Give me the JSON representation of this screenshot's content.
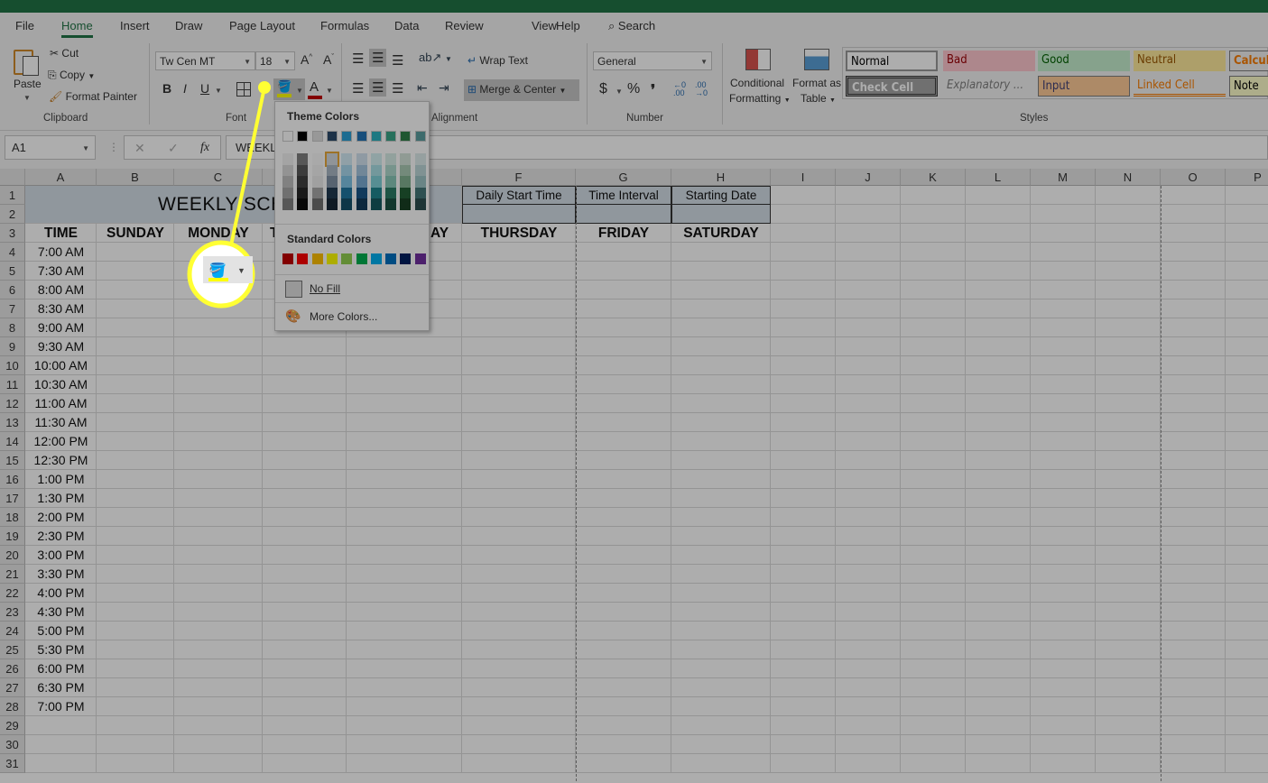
{
  "titlebar": {
    "color": "#217346"
  },
  "tabs": [
    {
      "label": "File"
    },
    {
      "label": "Home",
      "active": true
    },
    {
      "label": "Insert"
    },
    {
      "label": "Draw"
    },
    {
      "label": "Page Layout"
    },
    {
      "label": "Formulas"
    },
    {
      "label": "Data"
    },
    {
      "label": "Review"
    },
    {
      "label": "View"
    },
    {
      "label": "Help"
    }
  ],
  "search": {
    "label": "Search",
    "icon": "search-icon"
  },
  "clipboard": {
    "paste": "Paste",
    "cut": "Cut",
    "copy": "Copy",
    "format_painter": "Format Painter",
    "group": "Clipboard"
  },
  "font": {
    "name": "Tw Cen MT",
    "size": "18",
    "bold": "B",
    "italic": "I",
    "underline": "U",
    "font_color_glyph": "A",
    "group": "Font",
    "fill_color": "#ffff00",
    "font_color": "#c00000"
  },
  "alignment": {
    "wrap_text": "Wrap Text",
    "merge_center": "Merge & Center",
    "group": "Alignment"
  },
  "number": {
    "format": "General",
    "currency": "$",
    "percent": "%",
    "comma": "❜",
    "group": "Number"
  },
  "styles_group": {
    "conditional_1": "Conditional",
    "conditional_2": "Formatting",
    "table_1": "Format as",
    "table_2": "Table",
    "group": "Styles",
    "items": [
      {
        "label": "Normal",
        "bg": "#ffffff",
        "fg": "#000000"
      },
      {
        "label": "Bad",
        "bg": "#ffc7ce",
        "fg": "#9c0006"
      },
      {
        "label": "Good",
        "bg": "#c6efce",
        "fg": "#006100"
      },
      {
        "label": "Neutral",
        "bg": "#ffeb9c",
        "fg": "#9c5700"
      },
      {
        "label": "Calcul",
        "bg": "#f2f2f2",
        "fg": "#fa7d00"
      },
      {
        "label": "Check Cell",
        "bg": "#a5a5a5",
        "fg": "#ffffff"
      },
      {
        "label": "Explanatory ...",
        "bg": "#f3f3f3",
        "fg": "#7f7f7f"
      },
      {
        "label": "Input",
        "bg": "#ffcc99",
        "fg": "#3f3f76"
      },
      {
        "label": "Linked Cell",
        "bg": "#f3f3f3",
        "fg": "#fa7d00"
      },
      {
        "label": "Note",
        "bg": "#ffffcc",
        "fg": "#000000"
      }
    ]
  },
  "formula_bar": {
    "name_box": "A1",
    "cancel": "✕",
    "enter": "✓",
    "fx": "fx",
    "value": "WEEKL"
  },
  "fill_dropdown": {
    "theme_title": "Theme Colors",
    "theme_colors": [
      "#ffffff",
      "#000000",
      "#e0e0e0",
      "#2b4a6b",
      "#2a9fd6",
      "#2373b5",
      "#2bb3c0",
      "#3aa588",
      "#2f7f48",
      "#5a9ea0"
    ],
    "selected": "row 1, column 4",
    "standard_title": "Standard Colors",
    "standard_colors": [
      "#c00000",
      "#ff0000",
      "#ffc000",
      "#ffff00",
      "#92d050",
      "#00b050",
      "#00b0f0",
      "#0070c0",
      "#002060",
      "#7030a0"
    ],
    "no_fill": "No Fill",
    "more_colors": "More Colors..."
  },
  "sheet": {
    "columns": [
      "A",
      "B",
      "C",
      "D",
      "E",
      "F",
      "G",
      "H",
      "I",
      "J",
      "K",
      "L",
      "M",
      "N",
      "O",
      "P"
    ],
    "row_count": 31,
    "title_visible": "WEEKLY SCH",
    "header_bg": "#d5dfe8",
    "info_headers": {
      "F": "Daily Start Time",
      "G": "Time Interval",
      "H": "Starting Date"
    },
    "day_headers": {
      "A": "TIME",
      "B": "SUNDAY",
      "C": "MONDAY",
      "D": "T",
      "E": "AY",
      "F": "THURSDAY",
      "G": "FRIDAY",
      "H": "SATURDAY"
    },
    "times": [
      "7:00 AM",
      "7:30 AM",
      "8:00 AM",
      "8:30 AM",
      "9:00 AM",
      "9:30 AM",
      "10:00 AM",
      "10:30 AM",
      "11:00 AM",
      "11:30 AM",
      "12:00 PM",
      "12:30 PM",
      "1:00 PM",
      "1:30 PM",
      "2:00 PM",
      "2:30 PM",
      "3:00 PM",
      "3:30 PM",
      "4:00 PM",
      "4:30 PM",
      "5:00 PM",
      "5:30 PM",
      "6:00 PM",
      "6:30 PM",
      "7:00 PM"
    ]
  },
  "annotation": {
    "color": "#ffff33"
  }
}
